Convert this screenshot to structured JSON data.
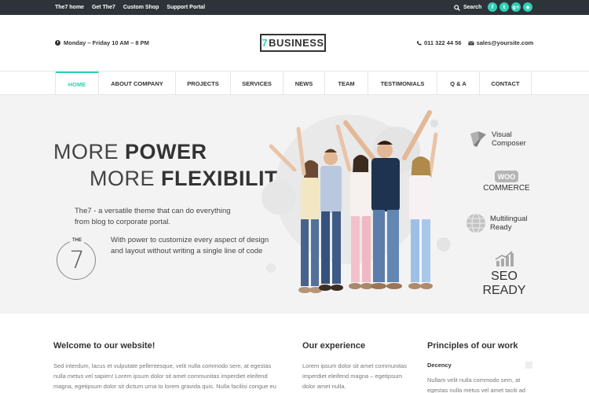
{
  "topbar": {
    "links": [
      "The7 home",
      "Get The7",
      "Custom Shop",
      "Support Portal"
    ],
    "search_label": "Search",
    "social_icons": [
      "facebook-icon",
      "twitter-icon",
      "google-plus-icon",
      "dribbble-icon"
    ],
    "social_glyphs": [
      "f",
      "t",
      "g+",
      "◉"
    ]
  },
  "header": {
    "hours": "Monday – Friday 10 AM – 8 PM",
    "logo_seven": "7",
    "logo_text": "BUSINESS",
    "phone": "011 322 44 56",
    "email": "sales@yoursite.com"
  },
  "nav": {
    "items": [
      "HOME",
      "ABOUT COMPANY",
      "PROJECTS",
      "SERVICES",
      "NEWS",
      "TEAM",
      "TESTIMONIALS",
      "Q & A",
      "CONTACT"
    ],
    "active_index": 0
  },
  "hero": {
    "line1_light": "MORE ",
    "line1_bold": "POWER",
    "line2_light": "MORE ",
    "line2_bold": "FLEXIBILITY",
    "description": "The7 - a versatile theme that can do everything from blog to corporate portal.",
    "badge_top": "THE",
    "badge_number": "7",
    "badge_text": "With power to customize every aspect of design and layout without writing a single line of code"
  },
  "features": {
    "visual_composer": "Visual Composer",
    "woo_badge": "WOO",
    "commerce": "COMMERCE",
    "multilingual": "Multilingual Ready",
    "seo": "SEO READY"
  },
  "content": {
    "welcome_title": "Welcome to our website!",
    "welcome_text": "Sed interdum, lacus et vulputate pellentesque, velit nulla commodo sem, at egestas nulla metus vel sapien! Lorem ipsum dolor sit amet communitas imperdiet eleifend magna, egetipsum dolor sit dictum urna to lorem gravida quis. Nulla facilisi congue eu",
    "experience_title": "Our experience",
    "experience_text": "Lorem ipsum dolor sit amet communitas imperdiet eleifend magna – egetipsum dolor amet nulla.",
    "principles_title": "Principles of our work",
    "principles_sub": "Decency",
    "principles_text": "Nullam velit nulla commodo sem, at egestas nulla metus vel amet taciti ad"
  },
  "colors": {
    "accent": "#2fd0b5",
    "topbar": "#2d3338",
    "hero_bg": "#f3f3f3"
  }
}
